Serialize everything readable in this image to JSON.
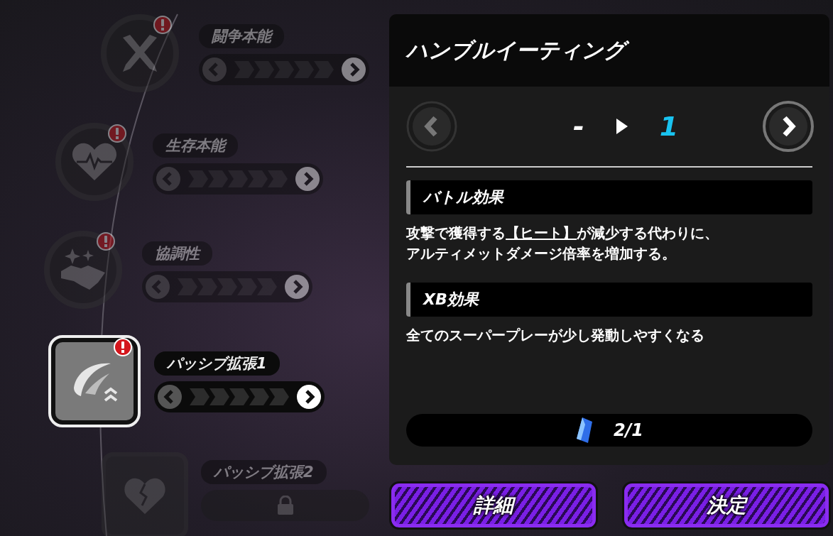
{
  "nodes": [
    {
      "label": "闘争本能",
      "kind": "circle",
      "selected": false,
      "alert": true,
      "locked": false
    },
    {
      "label": "生存本能",
      "kind": "circle",
      "selected": false,
      "alert": true,
      "locked": false
    },
    {
      "label": "協調性",
      "kind": "circle",
      "selected": false,
      "alert": true,
      "locked": false
    },
    {
      "label": "パッシブ拡張1",
      "kind": "square",
      "selected": true,
      "alert": true,
      "locked": false
    },
    {
      "label": "パッシブ拡張2",
      "kind": "square",
      "selected": false,
      "alert": false,
      "locked": true
    }
  ],
  "panel": {
    "title": "ハンブルイーティング",
    "level_from": "-",
    "level_to": "1",
    "sections": [
      {
        "heading": "バトル効果",
        "before": "攻撃で獲得する",
        "link": "【ヒート】",
        "after": "が減少する代わりに、",
        "line2": "アルティメットダメージ倍率を増加する。"
      },
      {
        "heading": "XB効果",
        "before": "全てのスーパープレーが少し発動しやすくなる"
      }
    ],
    "cost": "2/1"
  },
  "buttons": [
    "詳細",
    "決定"
  ]
}
